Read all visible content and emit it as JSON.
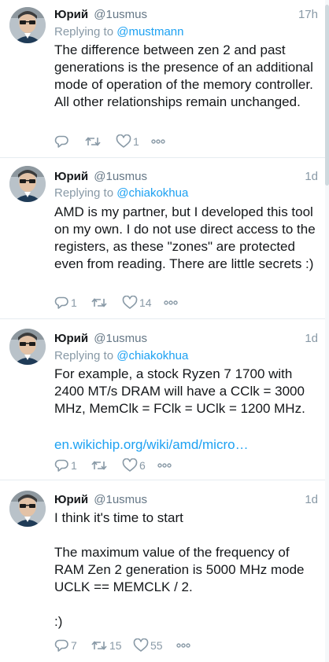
{
  "tweets": [
    {
      "author_name": "Юрий",
      "handle": "@1usmus",
      "time": "17h",
      "replying_to_label": "Replying to",
      "replying_to_user": "@mustmann",
      "text": "The difference between zen 2 and past generations is the presence of an additional mode of operation of the memory controller. All other relationships remain unchanged.",
      "link": "",
      "reply_count": "",
      "retweet_count": "",
      "like_count": "1"
    },
    {
      "author_name": "Юрий",
      "handle": "@1usmus",
      "time": "1d",
      "replying_to_label": "Replying to",
      "replying_to_user": "@chiakokhua",
      "text": "AMD is my partner, but I developed this tool on my own. I do not use direct access to the registers, as these \"zones\" are protected even from reading. There are little secrets :)",
      "link": "",
      "reply_count": "1",
      "retweet_count": "",
      "like_count": "14"
    },
    {
      "author_name": "Юрий",
      "handle": "@1usmus",
      "time": "1d",
      "replying_to_label": "Replying to",
      "replying_to_user": "@chiakokhua",
      "text": "For example, a stock Ryzen 7 1700 with 2400 MT/s DRAM will have a CClk = 3000 MHz, MemClk = FClk = UClk = 1200 MHz.",
      "link": "en.wikichip.org/wiki/amd/micro…",
      "reply_count": "1",
      "retweet_count": "",
      "like_count": "6"
    },
    {
      "author_name": "Юрий",
      "handle": "@1usmus",
      "time": "1d",
      "replying_to_label": "",
      "replying_to_user": "",
      "text": "I think it's time to start\n\nThe maximum value of the frequency of RAM Zen 2 generation is 5000 MHz mode UCLK == MEMCLK / 2.\n\n:)",
      "link": "",
      "reply_count": "7",
      "retweet_count": "15",
      "like_count": "55"
    }
  ],
  "icons": {
    "reply": "reply-icon",
    "retweet": "retweet-icon",
    "like": "heart-icon",
    "more": "more-icon"
  },
  "colors": {
    "link": "#1da1f2",
    "muted": "#8899a6",
    "text": "#14171a",
    "divider": "#e6ecf0"
  }
}
